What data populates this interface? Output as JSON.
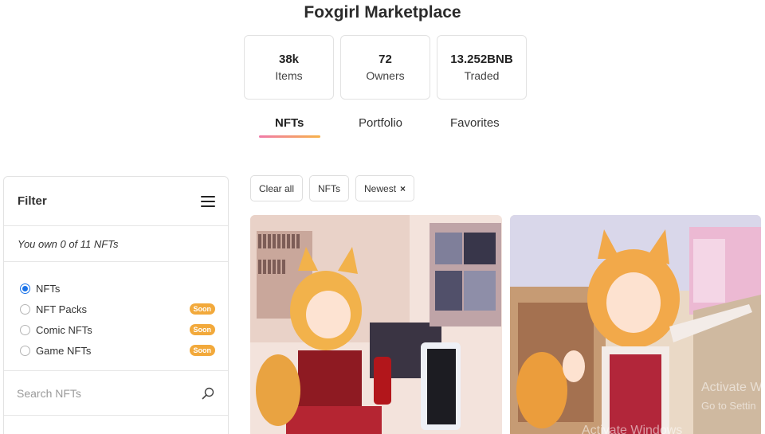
{
  "header": {
    "title": "Foxgirl Marketplace"
  },
  "stats": [
    {
      "value": "38k",
      "label": "Items"
    },
    {
      "value": "72",
      "label": "Owners"
    },
    {
      "value": "13.252BNB",
      "label": "Traded"
    }
  ],
  "tabs": [
    {
      "label": "NFTs",
      "active": true
    },
    {
      "label": "Portfolio",
      "active": false
    },
    {
      "label": "Favorites",
      "active": false
    }
  ],
  "filter": {
    "title": "Filter",
    "owned_text": "You own 0 of 11 NFTs",
    "options": [
      {
        "label": "NFTs",
        "checked": true,
        "badge": ""
      },
      {
        "label": "NFT Packs",
        "checked": false,
        "badge": "Soon"
      },
      {
        "label": "Comic NFTs",
        "checked": false,
        "badge": "Soon"
      },
      {
        "label": "Game NFTs",
        "checked": false,
        "badge": "Soon"
      }
    ],
    "search_placeholder": "Search NFTs"
  },
  "chips": [
    {
      "label": "Clear all"
    },
    {
      "label": "NFTs"
    },
    {
      "label": "Newest",
      "close": "×"
    }
  ],
  "watermark": {
    "line1": "Activate W",
    "line2": "Go to Settin",
    "line3": "Activate Windows"
  },
  "colors": {
    "accent_gradient_start": "#f07aa8",
    "accent_gradient_end": "#f7b24a",
    "badge": "#f2a93b",
    "radio": "#1a73e8"
  }
}
